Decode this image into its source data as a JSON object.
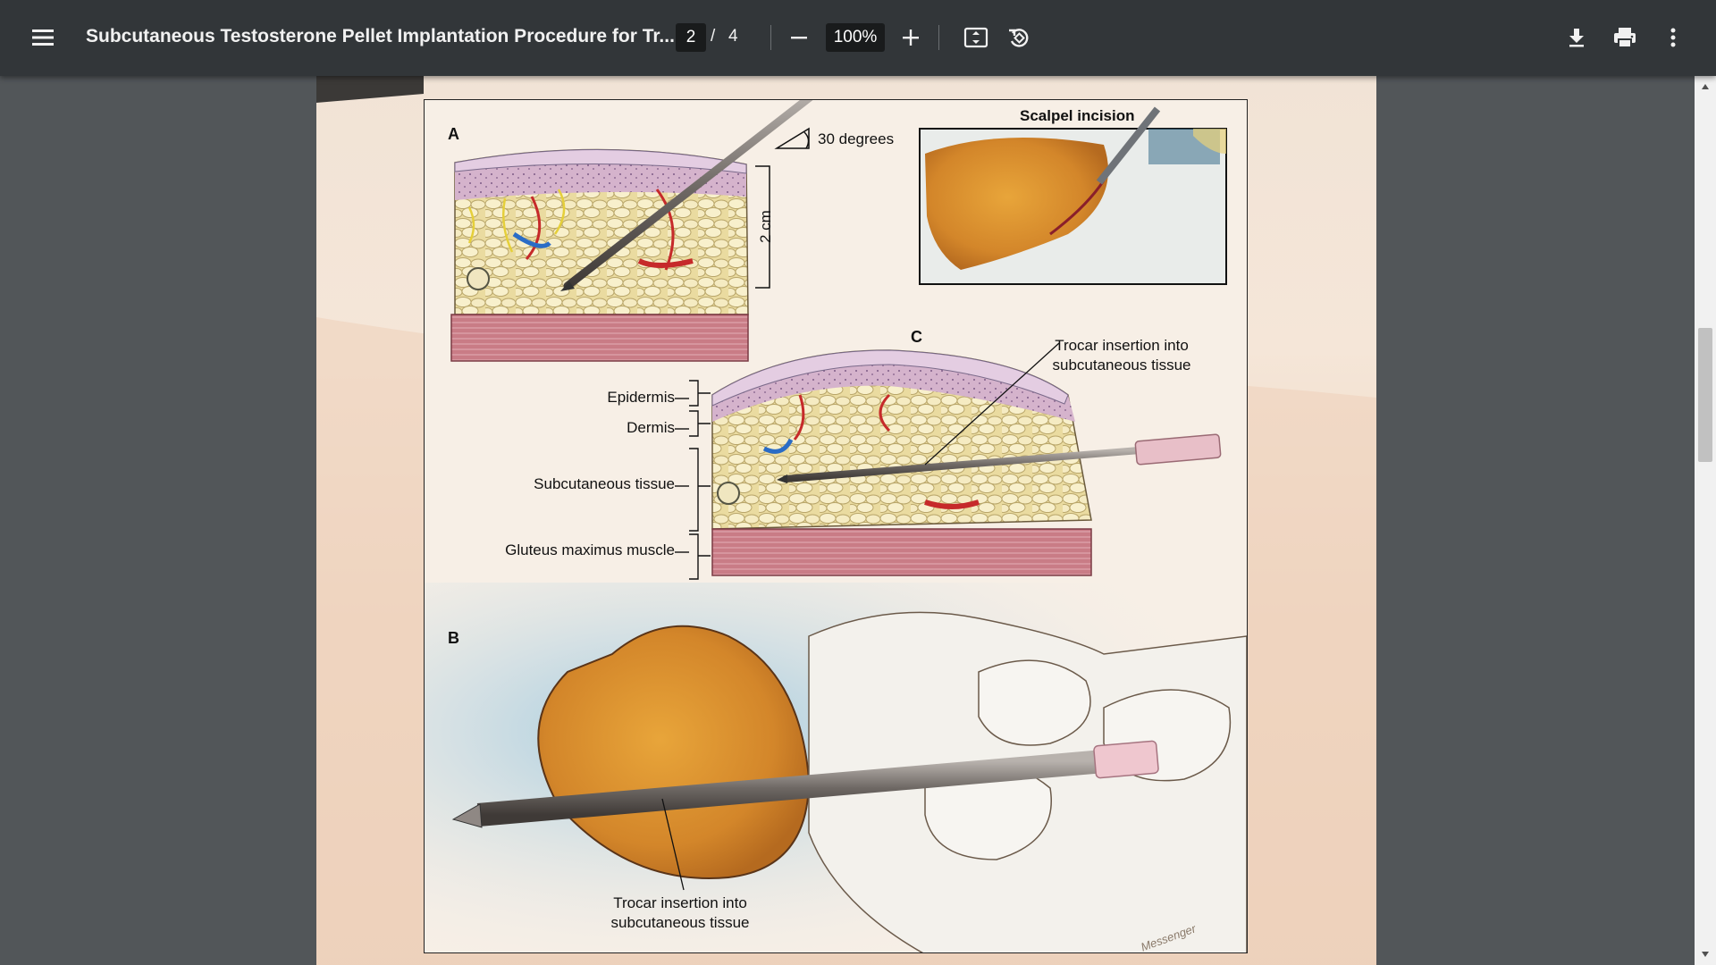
{
  "toolbar": {
    "title": "Subcutaneous Testosterone Pellet Implantation Procedure for Tr...",
    "page_current": "2",
    "page_separator": "/",
    "page_total": "4",
    "zoom": "100%"
  },
  "icons": {
    "menu": "hamburger-menu-icon",
    "zoom_out": "minus-icon",
    "zoom_in": "plus-icon",
    "fit": "fit-to-page-icon",
    "rotate": "rotate-counterclockwise-icon",
    "download": "download-icon",
    "print": "print-icon",
    "more": "more-vertical-icon"
  },
  "figure": {
    "panel_a": "A",
    "panel_b": "B",
    "panel_c": "C",
    "angle_label": "30 degrees",
    "depth_label": "2 cm",
    "inset_title": "Scalpel incision",
    "c_callout_line1": "Trocar insertion into",
    "c_callout_line2": "subcutaneous tissue",
    "layer_epidermis": "Epidermis",
    "layer_dermis": "Dermis",
    "layer_subcutaneous": "Subcutaneous tissue",
    "layer_muscle": "Gluteus maximus muscle",
    "b_callout_line1": "Trocar insertion into",
    "b_callout_line2": "subcutaneous tissue",
    "signature": "Messenger"
  },
  "colors": {
    "toolbar_bg": "#323639",
    "viewer_bg": "#525659",
    "fat": "#f3e4b0",
    "muscle": "#c97c86",
    "dermis": "#c9a3c2",
    "skin_orange": "#d98a2b"
  }
}
